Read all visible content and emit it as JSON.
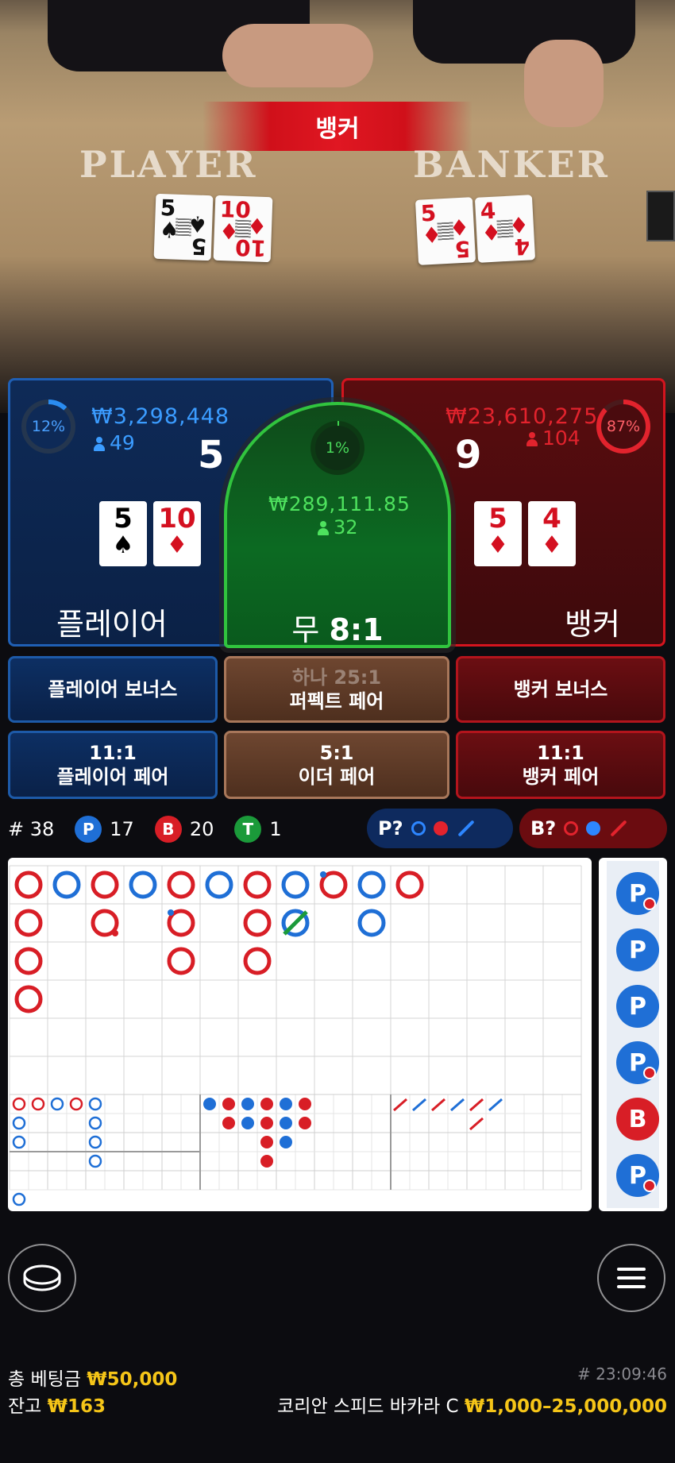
{
  "banner": {
    "winner": "뱅커"
  },
  "table": {
    "player_word": "PLAYER",
    "banker_word": "BANKER"
  },
  "player": {
    "percent": "12%",
    "amount": "₩3,298,448",
    "bettors": "49",
    "score": "5",
    "cards": [
      {
        "rank": "5",
        "suit": "♠",
        "color": "black"
      },
      {
        "rank": "10",
        "suit": "♦",
        "color": "red"
      }
    ],
    "label": "플레이어"
  },
  "banker": {
    "percent": "87%",
    "amount": "₩23,610,275",
    "bettors": "104",
    "score": "9",
    "cards": [
      {
        "rank": "5",
        "suit": "♦",
        "color": "red"
      },
      {
        "rank": "4",
        "suit": "♦",
        "color": "red"
      }
    ],
    "label": "뱅커"
  },
  "tie": {
    "percent": "1%",
    "amount": "₩289,111.85",
    "bettors": "32",
    "label": "무",
    "odds": "8:1"
  },
  "side_bets": {
    "player_bonus": "플레이어 보너스",
    "perfect_top": "하나 25:1",
    "perfect_label": "퍼펙트 페어",
    "banker_bonus": "뱅커 보너스",
    "player_pair_odds": "11:1",
    "player_pair_label": "플레이어 페어",
    "either_odds": "5:1",
    "either_label": "이더 페어",
    "banker_pair_odds": "11:1",
    "banker_pair_label": "뱅커 페어"
  },
  "stats": {
    "round": "# 38",
    "p_letter": "P",
    "p_count": "17",
    "b_letter": "B",
    "b_count": "20",
    "t_letter": "T",
    "t_count": "1"
  },
  "predict": {
    "player": "P?",
    "banker": "B?"
  },
  "big_road": [
    [
      {
        "r": 0,
        "c": 0,
        "o": "B"
      },
      {
        "r": 1,
        "c": 0,
        "o": "B"
      },
      {
        "r": 2,
        "c": 0,
        "o": "B"
      },
      {
        "r": 3,
        "c": 0,
        "o": "B"
      }
    ],
    [
      {
        "r": 0,
        "c": 1,
        "o": "P"
      }
    ],
    [
      {
        "r": 0,
        "c": 2,
        "o": "B"
      },
      {
        "r": 1,
        "c": 2,
        "o": "B",
        "pair": "banker"
      }
    ],
    [
      {
        "r": 0,
        "c": 3,
        "o": "P"
      }
    ],
    [
      {
        "r": 0,
        "c": 4,
        "o": "B"
      },
      {
        "r": 1,
        "c": 4,
        "o": "B",
        "pair": "player"
      },
      {
        "r": 2,
        "c": 4,
        "o": "B"
      }
    ],
    [
      {
        "r": 0,
        "c": 5,
        "o": "P"
      }
    ],
    [
      {
        "r": 0,
        "c": 6,
        "o": "B"
      },
      {
        "r": 1,
        "c": 6,
        "o": "B"
      },
      {
        "r": 2,
        "c": 6,
        "o": "B"
      }
    ],
    [
      {
        "r": 0,
        "c": 7,
        "o": "P"
      },
      {
        "r": 1,
        "c": 7,
        "o": "P",
        "tie": true
      }
    ],
    [
      {
        "r": 0,
        "c": 8,
        "o": "B",
        "pair": "player"
      }
    ],
    [
      {
        "r": 0,
        "c": 9,
        "o": "P"
      },
      {
        "r": 1,
        "c": 9,
        "o": "P"
      }
    ],
    [
      {
        "r": 0,
        "c": 10,
        "o": "B"
      }
    ]
  ],
  "side_road": [
    "P",
    "P",
    "P",
    "P",
    "B",
    "P"
  ],
  "side_road_pairs": [
    true,
    false,
    false,
    true,
    false,
    true
  ],
  "footer": {
    "total_bet_label": "총 베팅금",
    "total_bet": "₩50,000",
    "balance_label": "잔고",
    "balance": "₩163",
    "game_id": "# 23:09:46",
    "table_name": "코리안 스피드 바카라 C",
    "limits": "₩1,000–25,000,000"
  },
  "colors": {
    "player": "#1f6fd6",
    "banker": "#d81e26",
    "tie": "#1b9a3a",
    "gold": "#f5c518"
  },
  "icons": {
    "chips": "chip-stack-icon",
    "menu": "hamburger-menu-icon",
    "person": "person-icon"
  }
}
